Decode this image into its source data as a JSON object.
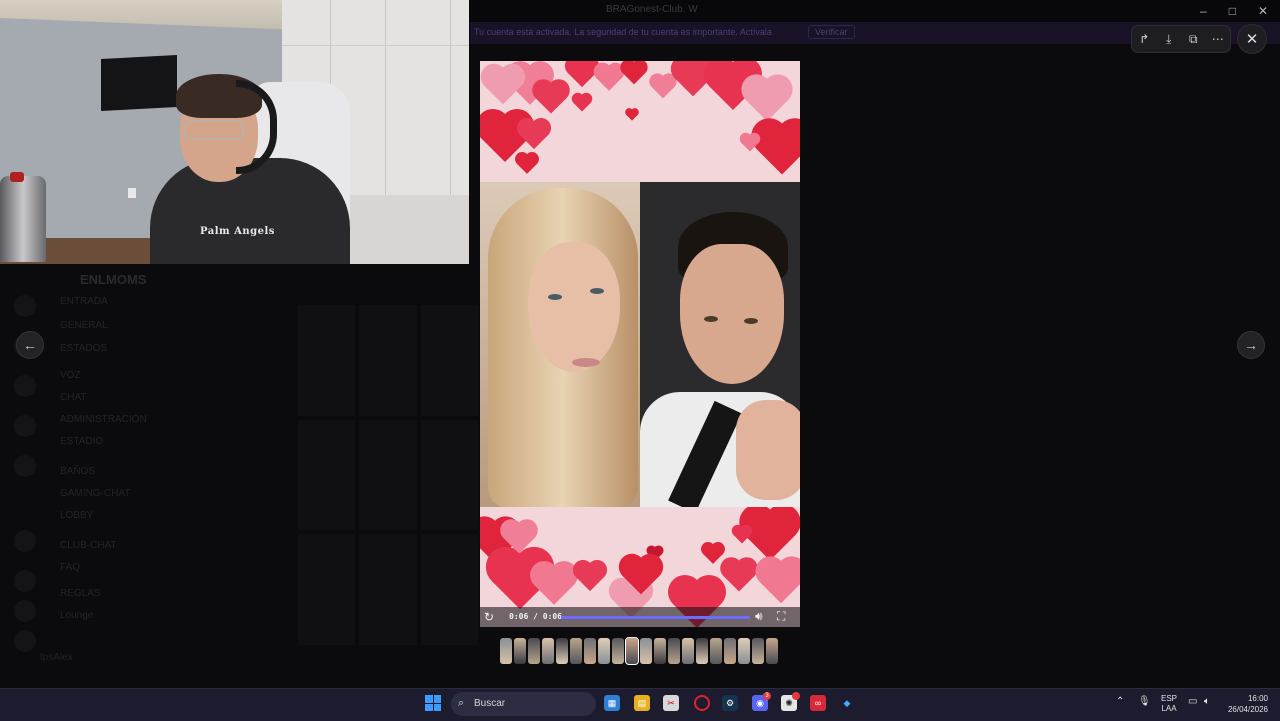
{
  "window": {
    "title": "BRAGonest-Club. W",
    "controls": [
      "–",
      "□",
      "✕"
    ]
  },
  "banner": {
    "text": "Tu cuenta está activada. La seguridad de tu cuenta es importante. Actívala",
    "button": "Verificar"
  },
  "server_sidebar": {
    "channel_header": "ENLMOMS",
    "channels": [
      "ENTRADA",
      "GENERAL",
      "ESTADOS",
      "VOZ",
      "CHAT",
      "ADMINISTRACION",
      "ESTADIO",
      "BAÑOS",
      "GAMING-CHAT",
      "LOBBY",
      "CLUB-CHAT",
      "FAQ",
      "REGLAS",
      "Lounge"
    ],
    "user": "tpsAlex"
  },
  "media_viewer": {
    "toolbar_icons": [
      "forward-icon",
      "download-icon",
      "open-external-icon",
      "more-icon"
    ],
    "close_icon": "close-icon",
    "prev_icon": "arrow-left-icon",
    "next_icon": "arrow-right-icon",
    "video": {
      "time_display": "0:06 / 0:06",
      "progress": 1.0
    },
    "thumbnail_count": 20
  },
  "taskbar": {
    "search_placeholder": "Buscar",
    "discord_badge": "3",
    "language_line1": "ESP",
    "language_line2": "LAA",
    "time": "16:00",
    "date": "26/04/2026"
  },
  "colors": {
    "accent": "#5865f2",
    "taskbar": "#1c1c2e",
    "heart_red": "#e2344e",
    "heart_pink": "#f08aa0"
  }
}
